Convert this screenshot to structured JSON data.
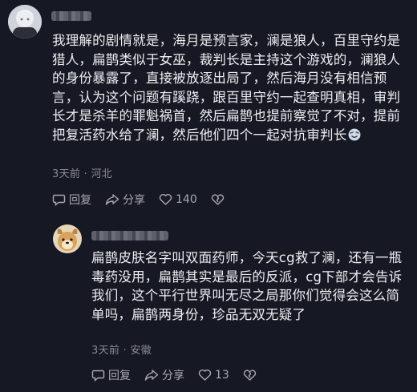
{
  "comments": [
    {
      "avatar_icon": "user-avatar-icon",
      "text": "我理解的剧情就是，海月是预言家，澜是狼人，百里守约是猎人，扁鹊类似于女巫，裁判长是主持这个游戏的，澜狼人的身份暴露了，直接被放逐出局了，然后海月没有相信预言，认为这个问题有蹊跷，跟百里守约一起查明真相，审判长才是杀羊的罪魁祸首，然后扁鹊也提前察觉了不对，提前把复活药水给了澜，然后他们四个一起对抗审判长",
      "emoji_icon": "smile-emoji-icon",
      "meta": "3天前 · 河北",
      "reply_label": "回复",
      "share_label": "分享",
      "like_count": "140"
    },
    {
      "avatar_icon": "dog-avatar-icon",
      "text": "扁鹊皮肤名字叫双面药师，今天cg救了澜，还有一瓶毒药没用，扁鹊其实是最后的反派，cg下部才会告诉我们，这个平行世界叫无尽之局那你们觉得会这么简单吗，扁鹊两身份，珍品无双无疑了",
      "meta": "3天前 · 安徽",
      "reply_label": "回复",
      "share_label": "分享",
      "like_count": "13"
    }
  ],
  "colors": {
    "background": "#161823",
    "text": "#eeeef0",
    "meta": "#8a8b91",
    "action": "#a9aab0"
  }
}
